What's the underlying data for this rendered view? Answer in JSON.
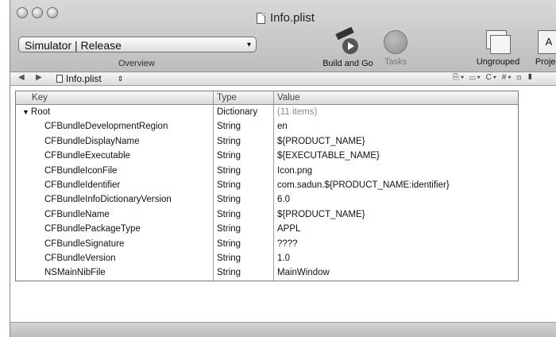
{
  "window": {
    "title": "Info.plist"
  },
  "toolbar": {
    "scheme": "Simulator | Release",
    "overview_label": "Overview",
    "build_and_go": "Build and Go",
    "tasks": "Tasks",
    "ungrouped": "Ungrouped",
    "project": "Project"
  },
  "navbar": {
    "file": "Info.plist",
    "right_controls": "⎘▾ ▭▾ C▾ #▾ ⊡ ▮"
  },
  "table": {
    "headers": {
      "key": "Key",
      "type": "Type",
      "value": "Value"
    },
    "root": {
      "key": "Root",
      "type": "Dictionary",
      "value": "(11 items)"
    },
    "rows": [
      {
        "key": "CFBundleDevelopmentRegion",
        "type": "String",
        "value": "en"
      },
      {
        "key": "CFBundleDisplayName",
        "type": "String",
        "value": "${PRODUCT_NAME}"
      },
      {
        "key": "CFBundleExecutable",
        "type": "String",
        "value": "${EXECUTABLE_NAME}"
      },
      {
        "key": "CFBundleIconFile",
        "type": "String",
        "value": "Icon.png"
      },
      {
        "key": "CFBundleIdentifier",
        "type": "String",
        "value": "com.sadun.${PRODUCT_NAME:identifier}"
      },
      {
        "key": "CFBundleInfoDictionaryVersion",
        "type": "String",
        "value": "6.0"
      },
      {
        "key": "CFBundleName",
        "type": "String",
        "value": "${PRODUCT_NAME}"
      },
      {
        "key": "CFBundlePackageType",
        "type": "String",
        "value": "APPL"
      },
      {
        "key": "CFBundleSignature",
        "type": "String",
        "value": "????"
      },
      {
        "key": "CFBundleVersion",
        "type": "String",
        "value": "1.0"
      },
      {
        "key": "NSMainNibFile",
        "type": "String",
        "value": "MainWindow"
      }
    ]
  }
}
